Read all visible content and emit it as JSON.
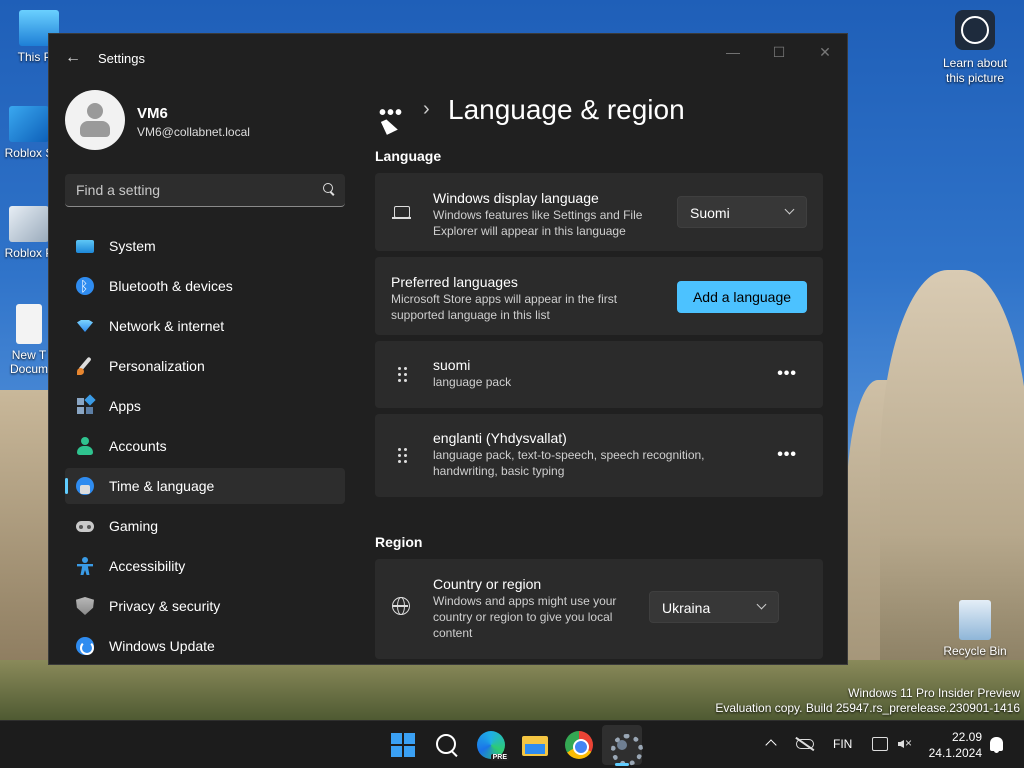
{
  "desktop": {
    "icons": [
      {
        "label": "This PC",
        "icon": "monitor-icon"
      },
      {
        "label": "Roblox S",
        "icon": "roblox-icon"
      },
      {
        "label": "Roblox P",
        "icon": "roblox-icon"
      },
      {
        "label": "New T Docum",
        "icon": "text-document-icon"
      },
      {
        "label": "Recycle Bin",
        "icon": "recycle-bin-icon"
      }
    ],
    "learn_about": "Learn about this picture",
    "watermark_line1": "Windows 11 Pro Insider Preview",
    "watermark_line2": "Evaluation copy. Build 25947.rs_prerelease.230901-1416"
  },
  "window": {
    "title": "Settings",
    "controls": {
      "minimize": "—",
      "maximize": "☐",
      "close": "✕"
    }
  },
  "profile": {
    "name": "VM6",
    "email": "VM6@collabnet.local"
  },
  "search": {
    "placeholder": "Find a setting"
  },
  "nav": {
    "items": [
      {
        "label": "System",
        "icon": "system-icon"
      },
      {
        "label": "Bluetooth & devices",
        "icon": "bluetooth-icon"
      },
      {
        "label": "Network & internet",
        "icon": "network-icon"
      },
      {
        "label": "Personalization",
        "icon": "brush-icon"
      },
      {
        "label": "Apps",
        "icon": "apps-icon"
      },
      {
        "label": "Accounts",
        "icon": "accounts-icon"
      },
      {
        "label": "Time & language",
        "icon": "time-language-icon",
        "active": true
      },
      {
        "label": "Gaming",
        "icon": "gaming-icon"
      },
      {
        "label": "Accessibility",
        "icon": "accessibility-icon"
      },
      {
        "label": "Privacy & security",
        "icon": "shield-icon"
      },
      {
        "label": "Windows Update",
        "icon": "update-icon"
      }
    ]
  },
  "content": {
    "breadcrumb_more": "•••",
    "breadcrumb_sep": "›",
    "page_title": "Language & region",
    "language_section": "Language",
    "display_language": {
      "title": "Windows display language",
      "subtitle": "Windows features like Settings and File Explorer will appear in this language",
      "value": "Suomi"
    },
    "preferred": {
      "title": "Preferred languages",
      "subtitle": "Microsoft Store apps will appear in the first supported language in this list",
      "button": "Add a language"
    },
    "languages": [
      {
        "name": "suomi",
        "detail": "language pack"
      },
      {
        "name": "englanti (Yhdysvallat)",
        "detail": "language pack, text-to-speech, speech recognition, handwriting, basic typing"
      }
    ],
    "more_label": "•••",
    "region_section": "Region",
    "country": {
      "title": "Country or region",
      "subtitle": "Windows and apps might use your country or region to give you local content",
      "value": "Ukraina"
    }
  },
  "taskbar": {
    "apps": [
      "start-icon",
      "search-icon",
      "edge-beta-icon",
      "file-explorer-icon",
      "chrome-icon",
      "settings-icon"
    ],
    "edge_badge": "PRE",
    "input_language": "FIN",
    "time": "22.09",
    "date": "24.1.2024"
  },
  "colors": {
    "accent": "#4cc2ff",
    "window_bg": "#202020",
    "card_bg": "#2b2b2b"
  }
}
